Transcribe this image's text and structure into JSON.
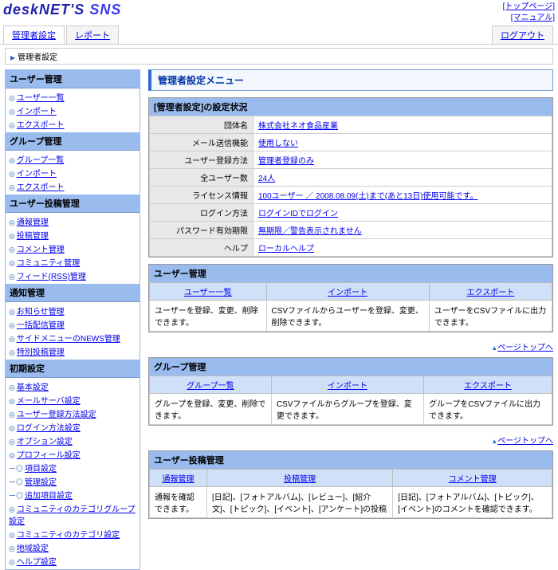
{
  "header": {
    "logo1": "deskNET'S",
    "logo2": "SNS",
    "links": [
      "[トップページ]",
      "[マニュアル]"
    ]
  },
  "tabs": {
    "admin": "管理者設定",
    "report": "レポート",
    "logout": "ログアウト"
  },
  "breadcrumb": "管理者設定",
  "sidebar": [
    {
      "head": "ユーザー管理",
      "items": [
        "ユーザー一覧",
        "インポート",
        "エクスポート"
      ]
    },
    {
      "head": "グループ管理",
      "items": [
        "グループ一覧",
        "インポート",
        "エクスポート"
      ]
    },
    {
      "head": "ユーザー投稿管理",
      "items": [
        "通報管理",
        "投稿管理",
        "コメント管理",
        "コミュニティ管理",
        "フィード(RSS)管理"
      ]
    },
    {
      "head": "通知管理",
      "items": [
        "お知らせ管理",
        "一括配信管理",
        "サイドメニューのNEWS管理",
        "特別投稿管理"
      ]
    },
    {
      "head": "初期設定",
      "items": [
        "基本設定",
        "メールサーバ設定",
        "ユーザー登録方法設定",
        "ログイン方法設定",
        "オプション設定",
        "プロフィール設定"
      ],
      "subs": [
        "項目設定",
        "管理設定",
        "追加項目設定"
      ],
      "tail": [
        "コミュニティのカテゴリグループ設定",
        "コミュニティのカテゴリ設定",
        "地域設定",
        "ヘルプ設定"
      ]
    }
  ],
  "title": "管理者設定メニュー",
  "status": {
    "head": "[管理者設定]の設定状況",
    "rows": [
      {
        "k": "団体名",
        "v": "株式会社ネオ食品産業"
      },
      {
        "k": "メール送信機能",
        "v": "使用しない"
      },
      {
        "k": "ユーザー登録方法",
        "v": "管理者登録のみ"
      },
      {
        "k": "全ユーザー数",
        "v": "24人"
      },
      {
        "k": "ライセンス情報",
        "v": "100ユーザー ／ 2008.08.09(土)まで(あと13日)使用可能です。"
      },
      {
        "k": "ログイン方法",
        "v": "ログインIDでログイン"
      },
      {
        "k": "パスワード有効期限",
        "v": "無期限／警告表示されません"
      },
      {
        "k": "ヘルプ",
        "v": "ローカルヘルプ"
      }
    ]
  },
  "sections": [
    {
      "head": "ユーザー管理",
      "cols": [
        {
          "h": "ユーザー一覧",
          "d": "ユーザーを登録、変更、削除できます。"
        },
        {
          "h": "インポート",
          "d": "CSVファイルからユーザーを登録、変更、削除できます。"
        },
        {
          "h": "エクスポート",
          "d": "ユーザーをCSVファイルに出力できます。"
        }
      ]
    },
    {
      "head": "グループ管理",
      "cols": [
        {
          "h": "グループ一覧",
          "d": "グループを登録、変更、削除できます。"
        },
        {
          "h": "インポート",
          "d": "CSVファイルからグループを登録、変更できます。"
        },
        {
          "h": "エクスポート",
          "d": "グループをCSVファイルに出力できます。"
        }
      ]
    },
    {
      "head": "ユーザー投稿管理",
      "cols": [
        {
          "h": "通報管理",
          "d": "通報を確認できます。"
        },
        {
          "h": "投稿管理",
          "d": "[日記]、[フォトアルバム]、[レビュー]、[紹介文]、[トピック]、[イベント]、[アンケート]の投稿"
        },
        {
          "h": "コメント管理",
          "d": "[日記]、[フォトアルバム]、[トピック]、[イベント]のコメントを確認できます。"
        }
      ]
    }
  ],
  "pagetop": "ページトップへ"
}
